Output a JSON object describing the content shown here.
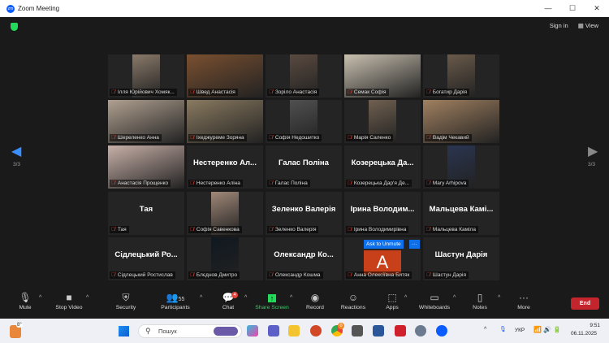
{
  "window": {
    "title": "Zoom Meeting"
  },
  "header": {
    "sign_in": "Sign in",
    "view": "View"
  },
  "pager": {
    "page": "3/3"
  },
  "tiles": [
    {
      "label": "Ілля Юрійович Хомяк...",
      "video": "#8a7a6a"
    },
    {
      "label": "Швед Анастасія",
      "video": "#7a5030"
    },
    {
      "label": "Зоріло Анастасія",
      "video": "#5a4a40"
    },
    {
      "label": "Семак Софія",
      "video": "#c9c0b0"
    },
    {
      "label": "Богатир Дарія",
      "video": "#6a5a4a"
    },
    {
      "label": "Шереленко Анна",
      "video": "#b0a090"
    },
    {
      "label": "Іхеджуреме Зоряна",
      "video": "#8a7a60"
    },
    {
      "label": "Софія Недошитко",
      "video": "#505050"
    },
    {
      "label": "Марія Саленко",
      "video": "#706050"
    },
    {
      "label": "Вадім Чекавий",
      "video": "#a08060"
    },
    {
      "label": "Анастасія Прощенко",
      "video": "#c8b0a8"
    },
    {
      "big": "Нестеренко Ал...",
      "label": "Нестеренко Аліна"
    },
    {
      "big": "Галас Поліна",
      "label": "Галас Поліна"
    },
    {
      "big": "Козерецька Да...",
      "label": "Козерецька Дар'я Де..."
    },
    {
      "label": "Mary Arhipova",
      "video": "#2a3550"
    },
    {
      "big": "Тая",
      "label": "Тая"
    },
    {
      "label": "Софія Савенкова",
      "video": "#a08878"
    },
    {
      "big": "Зеленко Валерія",
      "label": "Зеленко Валерія"
    },
    {
      "big": "Ірина Володим...",
      "label": "Ірина Володимирівна"
    },
    {
      "big": "Мальцева Камі...",
      "label": "Мальцева Каміла"
    },
    {
      "big": "Сідлецький Ро...",
      "label": "Сідлецький Ростислав"
    },
    {
      "label": "Блєднов Дмитро",
      "video": "#101820"
    },
    {
      "big": "Олександр Ко...",
      "label": "Олександр Кошма"
    },
    {
      "label": "Анна Олексіївна Битяк",
      "avatar": "A",
      "avatar_color": "#c8401a"
    },
    {
      "big": "Шастун Дарія",
      "label": "Шастун Дарія"
    }
  ],
  "hover": {
    "ask_to_unmute": "Ask to Unmute",
    "more": "···"
  },
  "toolbar": {
    "mute": "Mute",
    "stop_video": "Stop Video",
    "security": "Security",
    "participants": "Participants",
    "participants_count": "55",
    "chat": "Chat",
    "chat_badge": "4",
    "share_screen": "Share Screen",
    "record": "Record",
    "reactions": "Reactions",
    "apps": "Apps",
    "whiteboards": "Whiteboards",
    "notes": "Notes",
    "more": "More",
    "end": "End"
  },
  "taskbar": {
    "weather": "8°",
    "search_placeholder": "Пошук",
    "language": "УКР",
    "time": "9:51",
    "date": "06.11.2025",
    "chrome_badge": "0"
  }
}
